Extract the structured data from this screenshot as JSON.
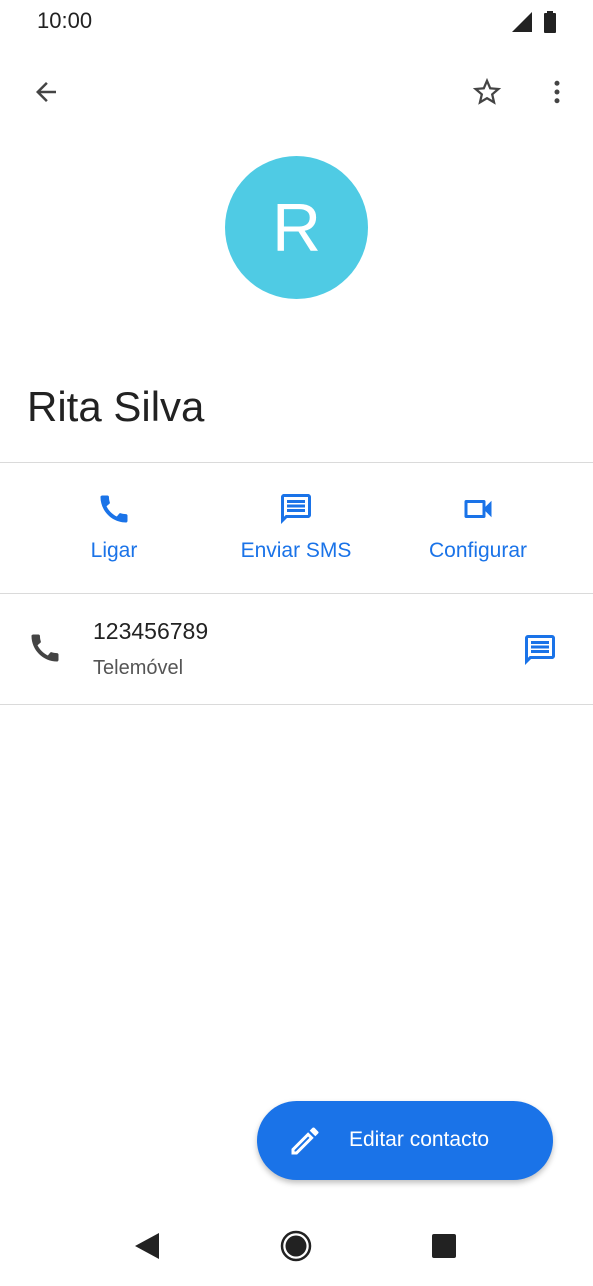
{
  "status_bar": {
    "time": "10:00",
    "icons": [
      "signal-icon",
      "battery-icon"
    ]
  },
  "top_bar": {
    "icons": [
      "back-arrow-icon",
      "star-outline-icon",
      "more-vert-icon"
    ]
  },
  "contact": {
    "avatar_letter": "R",
    "avatar_color": "#4fcbe4",
    "name": "Rita Silva"
  },
  "actions": [
    {
      "label": "Ligar",
      "icon": "phone-icon"
    },
    {
      "label": "Enviar SMS",
      "icon": "message-icon"
    },
    {
      "label": "Configurar",
      "icon": "video-icon"
    }
  ],
  "phone_entry": {
    "number": "123456789",
    "type": "Telemóvel",
    "icons": [
      "phone-icon",
      "message-icon"
    ]
  },
  "fab": {
    "label": "Editar contacto",
    "icon": "edit-pencil-icon"
  },
  "nav_bar": {
    "icons": [
      "nav-back-icon",
      "nav-home-icon",
      "nav-recents-icon"
    ]
  },
  "colors": {
    "accent": "#1a73e8",
    "text_primary": "#222222",
    "text_secondary": "#555555",
    "divider": "#dadada"
  }
}
